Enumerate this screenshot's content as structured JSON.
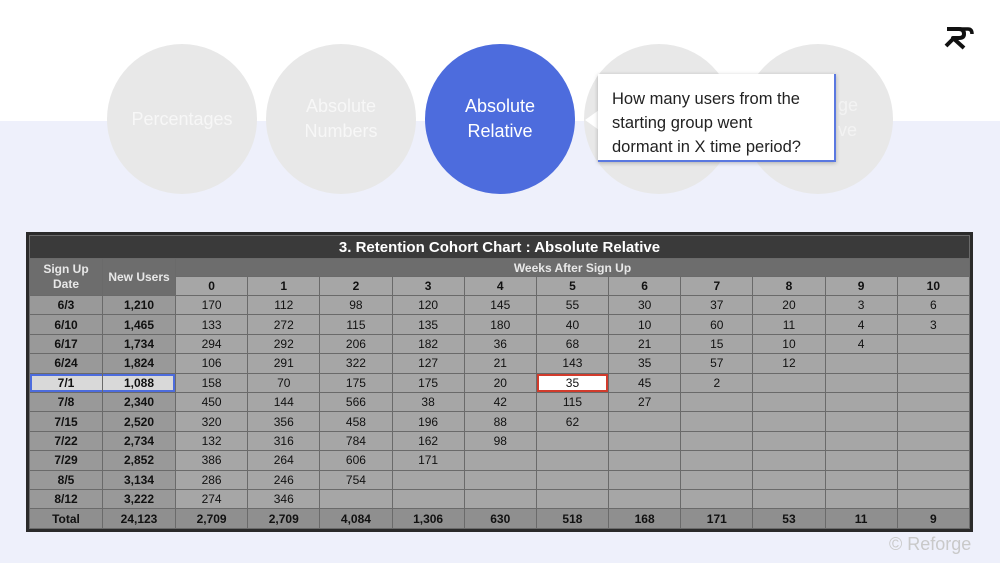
{
  "nav": {
    "circles": [
      {
        "label": "Percentages",
        "active": false
      },
      {
        "label": "Absolute\nNumbers",
        "active": false
      },
      {
        "label": "Absolute\nRelative",
        "active": true
      },
      {
        "label": "",
        "active": false
      },
      {
        "label": "",
        "active": false
      }
    ],
    "peek_left": "ge",
    "peek_right": "ve"
  },
  "tooltip": {
    "text": "How many users from the\nstarting group went\ndormant in X time period?"
  },
  "colors": {
    "accent": "#4d6cdd",
    "highlight": "#d13b2c"
  },
  "chart_data": {
    "type": "table",
    "title": "3. Retention Cohort Chart : Absolute Relative",
    "row_header_label": "Sign Up Date",
    "users_header_label": "New Users",
    "weeks_header_label": "Weeks After Sign Up",
    "weeks": [
      "0",
      "1",
      "2",
      "3",
      "4",
      "5",
      "6",
      "7",
      "8",
      "9",
      "10"
    ],
    "rows": [
      {
        "date": "6/3",
        "users": "1,210",
        "values": [
          "170",
          "112",
          "98",
          "120",
          "145",
          "55",
          "30",
          "37",
          "20",
          "3",
          "6"
        ]
      },
      {
        "date": "6/10",
        "users": "1,465",
        "values": [
          "133",
          "272",
          "115",
          "135",
          "180",
          "40",
          "10",
          "60",
          "11",
          "4",
          "3"
        ]
      },
      {
        "date": "6/17",
        "users": "1,734",
        "values": [
          "294",
          "292",
          "206",
          "182",
          "36",
          "68",
          "21",
          "15",
          "10",
          "4",
          ""
        ]
      },
      {
        "date": "6/24",
        "users": "1,824",
        "values": [
          "106",
          "291",
          "322",
          "127",
          "21",
          "143",
          "35",
          "57",
          "12",
          "",
          ""
        ]
      },
      {
        "date": "7/1",
        "users": "1,088",
        "values": [
          "158",
          "70",
          "175",
          "175",
          "20",
          "35",
          "45",
          "2",
          "",
          "",
          ""
        ]
      },
      {
        "date": "7/8",
        "users": "2,340",
        "values": [
          "450",
          "144",
          "566",
          "38",
          "42",
          "115",
          "27",
          "",
          "",
          "",
          ""
        ]
      },
      {
        "date": "7/15",
        "users": "2,520",
        "values": [
          "320",
          "356",
          "458",
          "196",
          "88",
          "62",
          "",
          "",
          "",
          "",
          ""
        ]
      },
      {
        "date": "7/22",
        "users": "2,734",
        "values": [
          "132",
          "316",
          "784",
          "162",
          "98",
          "",
          "",
          "",
          "",
          "",
          ""
        ]
      },
      {
        "date": "7/29",
        "users": "2,852",
        "values": [
          "386",
          "264",
          "606",
          "171",
          "",
          "",
          "",
          "",
          "",
          "",
          ""
        ]
      },
      {
        "date": "8/5",
        "users": "3,134",
        "values": [
          "286",
          "246",
          "754",
          "",
          "",
          "",
          "",
          "",
          "",
          "",
          ""
        ]
      },
      {
        "date": "8/12",
        "users": "3,222",
        "values": [
          "274",
          "346",
          "",
          "",
          "",
          "",
          "",
          "",
          "",
          "",
          ""
        ]
      }
    ],
    "total": {
      "label": "Total",
      "users": "24,123",
      "values": [
        "2,709",
        "2,709",
        "4,084",
        "1,306",
        "630",
        "518",
        "168",
        "171",
        "53",
        "11",
        "9"
      ]
    },
    "selected_row": "7/1",
    "highlighted_cell": {
      "row": "7/1",
      "week": "5"
    }
  },
  "footer": {
    "text": "© Reforge"
  }
}
